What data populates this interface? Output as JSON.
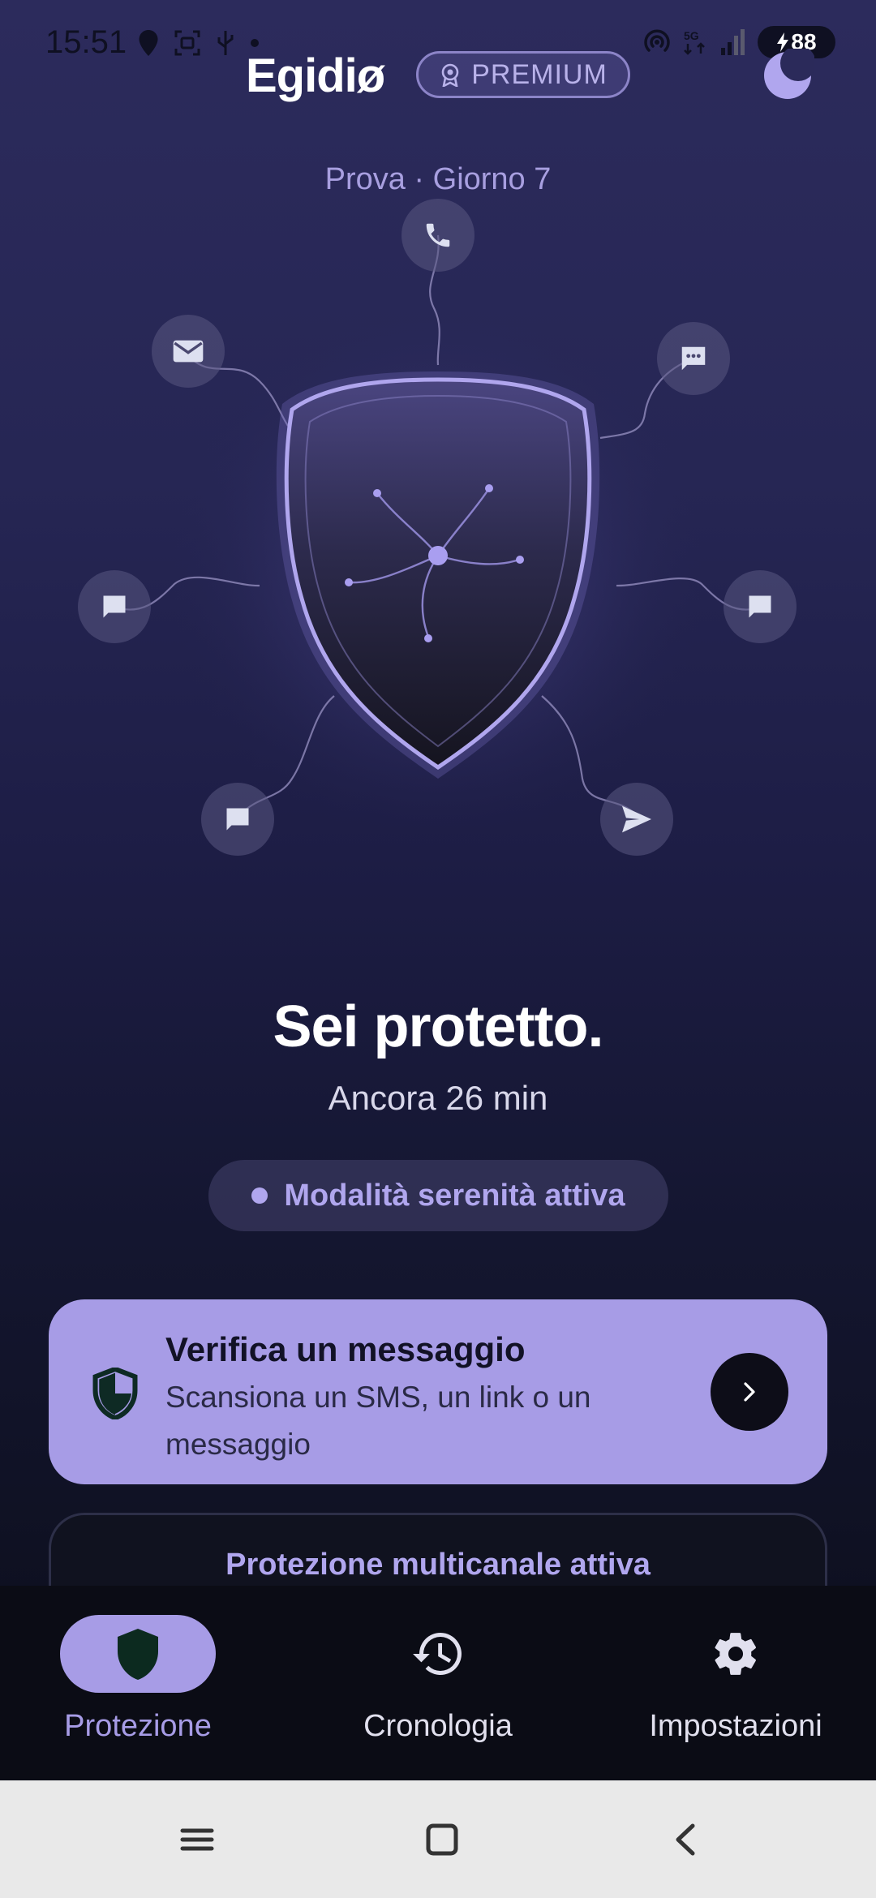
{
  "status_bar": {
    "time": "15:51",
    "battery_level": "88",
    "icons_left": [
      "location-icon",
      "screen-record-icon",
      "usb-icon",
      "notification-dot-icon"
    ],
    "icons_right": [
      "hotspot-icon",
      "5g-icon",
      "signal-icon",
      "battery-charging-icon"
    ]
  },
  "header": {
    "app_name": "Egidiø",
    "premium_label": "PREMIUM",
    "theme_icon": "moon-icon"
  },
  "trial_label": "Prova · Giorno 7",
  "protection_art": {
    "center_icon": "shield-icon",
    "channels": [
      "phone-icon",
      "email-icon",
      "chat-bubble-icon",
      "message-icon",
      "message-icon",
      "message-icon",
      "send-icon"
    ]
  },
  "status": {
    "heading": "Sei protetto.",
    "remaining": "Ancora 26 min",
    "mode_label": "Modalità serenità attiva"
  },
  "verify_card": {
    "title": "Verifica un messaggio",
    "description": "Scansiona un SMS, un link o un messaggio"
  },
  "multichannel_card": {
    "label": "Protezione multicanale attiva"
  },
  "bottom_nav": {
    "items": [
      {
        "label": "Protezione",
        "icon": "shield-icon",
        "active": true
      },
      {
        "label": "Cronologia",
        "icon": "history-icon",
        "active": false
      },
      {
        "label": "Impostazioni",
        "icon": "gear-icon",
        "active": false
      }
    ]
  },
  "colors": {
    "accent": "#a79ce6",
    "background_top": "#2c2b5c",
    "background_bottom": "#0a0c18",
    "nav_background": "#0b0c15"
  }
}
